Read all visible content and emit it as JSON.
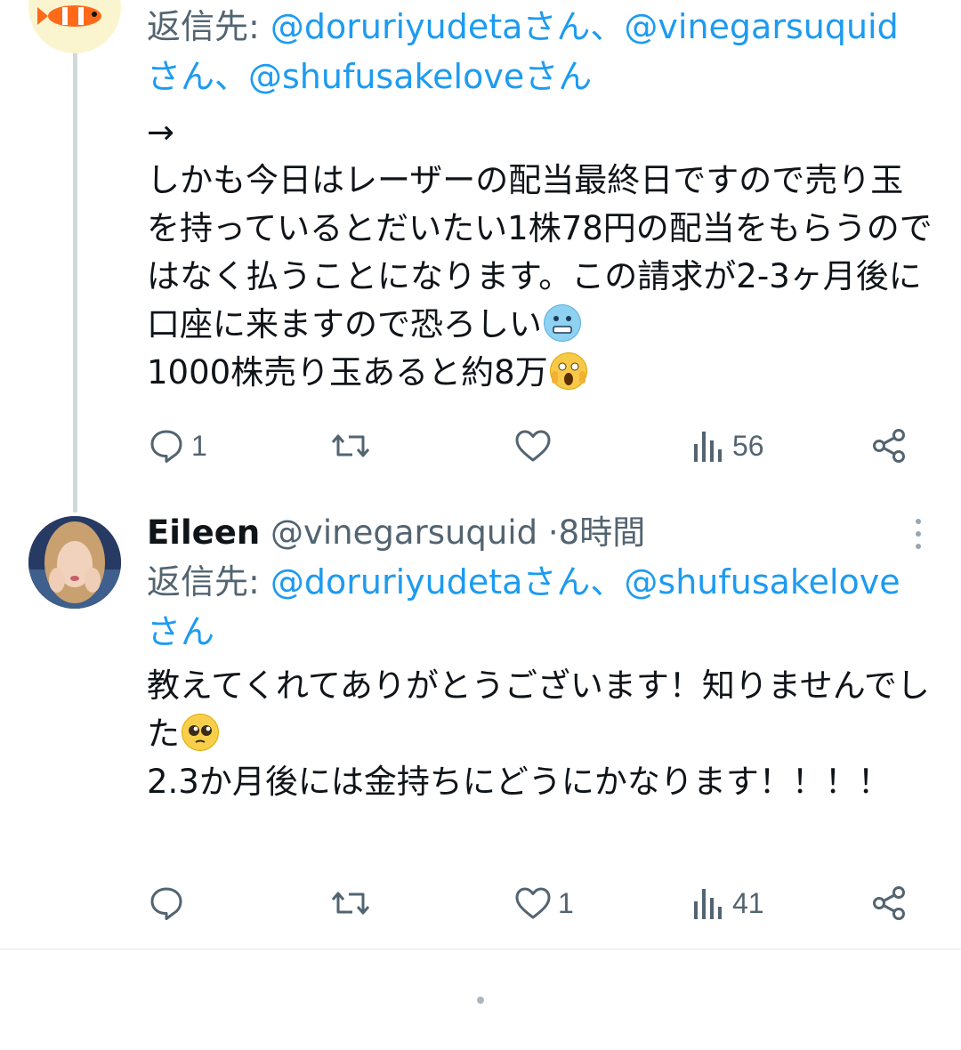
{
  "tweets": [
    {
      "reply_prefix": "返信先: ",
      "reply_mentions": [
        "@doruriyudetaさん、",
        "@vinegarsuquid",
        "さん、@shufusakeloveさん"
      ],
      "text_line_1": "→",
      "text_body": "しかも今日はレーザーの配当最終日ですので売り玉を持っているとだいたい1株78円の配当をもらうのではなく払うことになります。この請求が2-3ヶ月後に口座に来ますので恐ろしい",
      "text_tail": "1000株売り玉あると約8万",
      "emoji_1": "cold-face-emoji",
      "emoji_2": "screaming-face-emoji",
      "actions": {
        "reply_count": "1",
        "retweet_count": "",
        "like_count": "",
        "views_count": "56"
      }
    },
    {
      "name": "Eileen",
      "handle": "@vinegarsuquid",
      "separator": "·",
      "time": "8時間",
      "reply_prefix": "返信先: ",
      "reply_mentions": [
        "@doruriyudetaさん、@shufusakelove",
        "さん"
      ],
      "text_a": "教えてくれてありがとうございます！知りませんでした",
      "text_b": "2.3か月後には金持ちにどうにかなります！！！！",
      "emoji_1": "pleading-face-emoji",
      "actions": {
        "reply_count": "",
        "retweet_count": "",
        "like_count": "1",
        "views_count": "41"
      }
    }
  ],
  "colors": {
    "link": "#1d9bf0",
    "secondary": "#536471",
    "text": "#0f1419"
  }
}
